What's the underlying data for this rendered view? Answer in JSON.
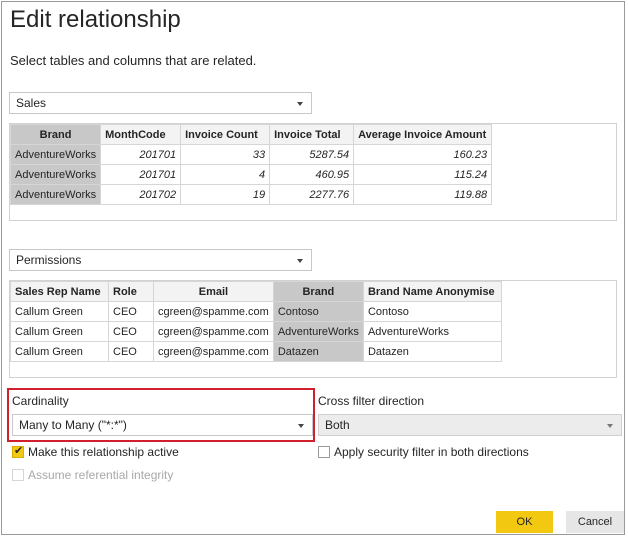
{
  "dialog": {
    "title": "Edit relationship",
    "subtitle": "Select tables and columns that are related."
  },
  "table1": {
    "selected": "Sales",
    "columns": [
      "Brand",
      "MonthCode",
      "Invoice Count",
      "Invoice Total",
      "Average Invoice Amount"
    ],
    "rows": [
      [
        "AdventureWorks",
        "201701",
        "33",
        "5287.54",
        "160.23"
      ],
      [
        "AdventureWorks",
        "201701",
        "4",
        "460.95",
        "115.24"
      ],
      [
        "AdventureWorks",
        "201702",
        "19",
        "2277.76",
        "119.88"
      ]
    ]
  },
  "table2": {
    "selected": "Permissions",
    "columns": [
      "Sales Rep Name",
      "Role",
      "Email",
      "Brand",
      "Brand Name Anonymise"
    ],
    "rows": [
      [
        "Callum Green",
        "CEO",
        "cgreen@spamme.com",
        "Contoso",
        "Contoso"
      ],
      [
        "Callum Green",
        "CEO",
        "cgreen@spamme.com",
        "AdventureWorks",
        "AdventureWorks"
      ],
      [
        "Callum Green",
        "CEO",
        "cgreen@spamme.com",
        "Datazen",
        "Datazen"
      ]
    ]
  },
  "cardinality": {
    "label": "Cardinality",
    "value": "Many to Many (\"*:*\")"
  },
  "cross_filter": {
    "label": "Cross filter direction",
    "value": "Both"
  },
  "options": {
    "active": {
      "label": "Make this relationship active",
      "checked": true
    },
    "security": {
      "label": "Apply security filter in both directions",
      "checked": false
    },
    "referential": {
      "label": "Assume referential integrity",
      "checked": false,
      "disabled": true
    }
  },
  "buttons": {
    "ok": "OK",
    "cancel": "Cancel"
  },
  "colors": {
    "accent": "#f2c811",
    "highlight_border": "#d0202e",
    "selected_column": "#c8c8c8"
  }
}
